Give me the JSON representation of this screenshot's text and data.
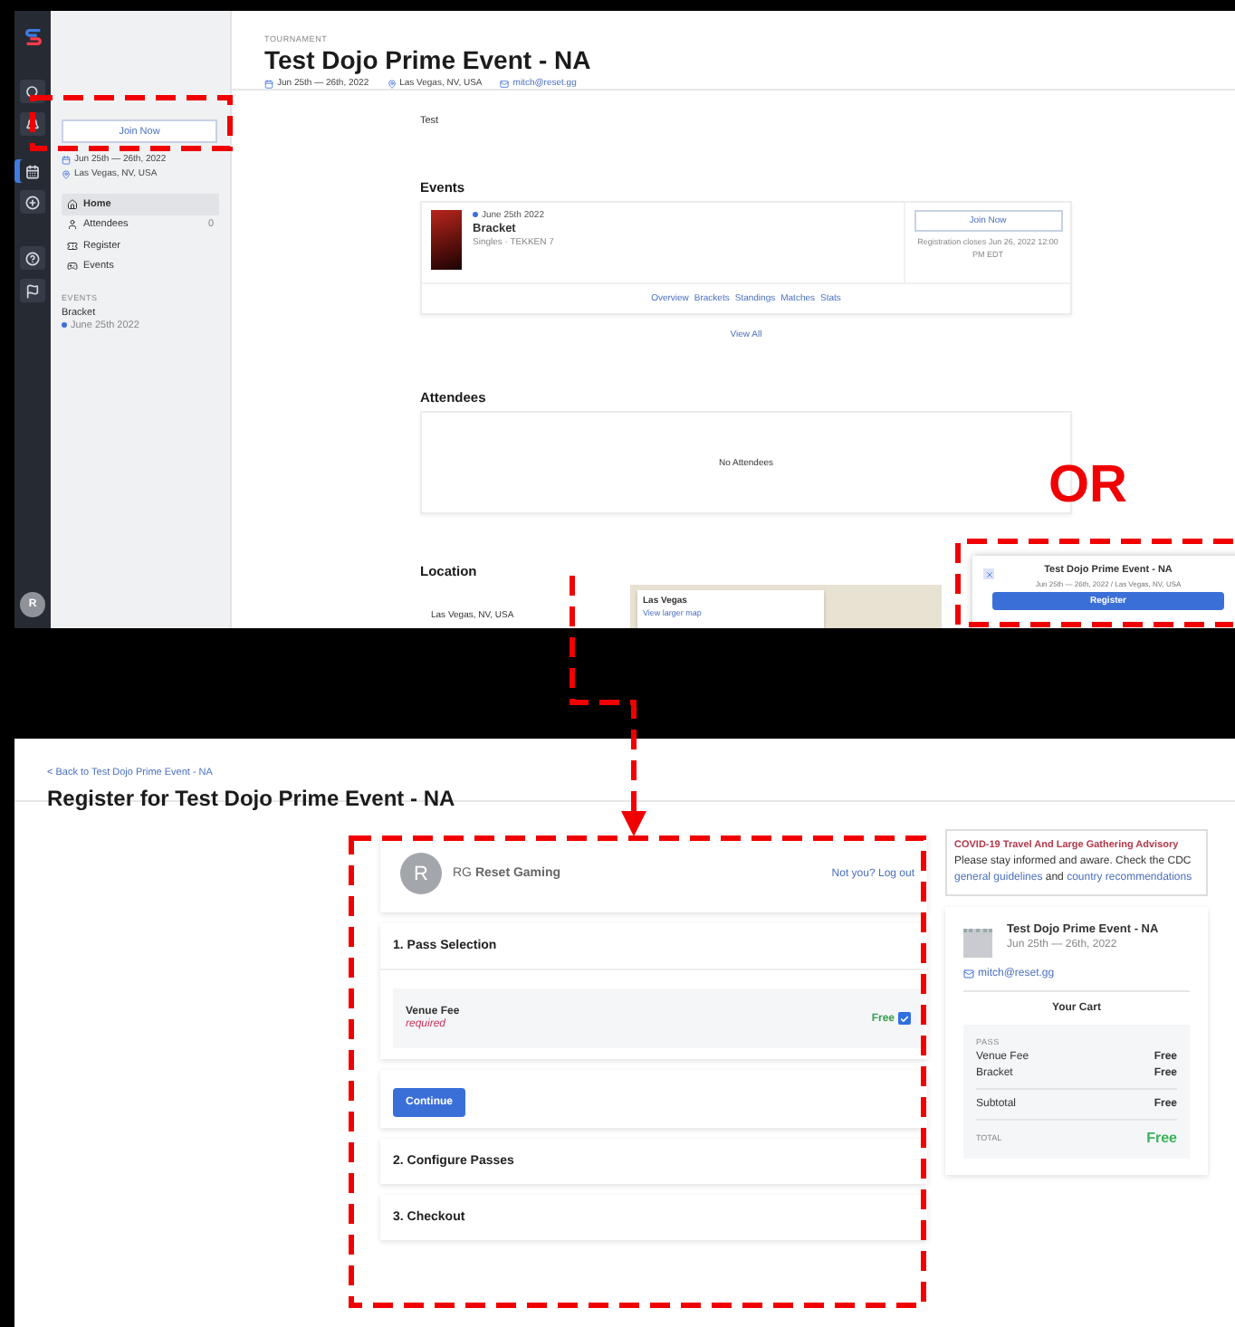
{
  "event_page": {
    "nav_rail": [
      {
        "selected": false
      },
      {
        "selected": false
      },
      {
        "selected": true
      },
      {
        "selected": false
      },
      {
        "selected": false
      },
      {
        "selected": false
      }
    ],
    "avatar_initial": "R",
    "sidebar": {
      "join_button": "Join Now",
      "date": "Jun 25th — 26th, 2022",
      "location": "Las Vegas, NV, USA",
      "items": [
        {
          "label": "Home",
          "selected": true
        },
        {
          "label": "Attendees",
          "count": "0",
          "selected": false
        },
        {
          "label": "Register",
          "selected": false
        },
        {
          "label": "Events",
          "selected": false
        }
      ],
      "events_heading": "EVENTS",
      "events": [
        {
          "name": "Bracket",
          "date": "June 25th 2022"
        }
      ]
    },
    "header": {
      "eyebrow": "TOURNAMENT",
      "title": "Test Dojo Prime Event - NA",
      "date": "Jun 25th — 26th, 2022",
      "location": "Las Vegas, NV, USA",
      "email": "mitch@reset.gg"
    },
    "description": "Test",
    "events_section": {
      "heading": "Events",
      "event": {
        "date": "June 25th 2022",
        "name": "Bracket",
        "subtitle": "Singles · TEKKEN 7",
        "join_button": "Join Now",
        "registration_note": "Registration closes Jun 26, 2022 12:00 PM EDT",
        "links": [
          "Overview",
          "Brackets",
          "Standings",
          "Matches",
          "Stats"
        ]
      },
      "view_all": "View All"
    },
    "attendees_section": {
      "heading": "Attendees",
      "empty_text": "No Attendees"
    },
    "location_section": {
      "heading": "Location",
      "address": "Las Vegas, NV, USA",
      "map_card": {
        "place": "Las Vegas",
        "link": "View larger map"
      }
    },
    "popup": {
      "title": "Test Dojo Prime Event - NA",
      "subtitle": "Jun 25th — 26th, 2022 / Las Vegas, NV, USA",
      "button": "Register"
    }
  },
  "annotation": {
    "label": "OR"
  },
  "register_page": {
    "back_link": "< Back to Test Dojo Prime Event - NA",
    "title": "Register for Test Dojo Prime Event - NA",
    "profile": {
      "initial": "R",
      "name": "RG **Reset Gaming**",
      "logout": "Not you? Log out"
    },
    "steps": [
      {
        "title": "1. Pass Selection",
        "expanded": true
      },
      {
        "title": "2. Configure Passes",
        "expanded": false
      },
      {
        "title": "3. Checkout",
        "expanded": false
      }
    ],
    "passes": [
      {
        "name": "Venue Fee",
        "note": "required",
        "price": "Free",
        "checked": true
      }
    ],
    "continue_button": "Continue",
    "advisory": {
      "title": "COVID-19 Travel And Large Gathering Advisory",
      "text_before": "Please stay informed and aware. Check the CDC",
      "link_1": "general guidelines",
      "text_middle": "and",
      "link_2": "country recommendations"
    },
    "event_card": {
      "title": "Test Dojo Prime Event - NA",
      "date": "Jun 25th — 26th, 2022",
      "email": "mitch@reset.gg"
    },
    "cart": {
      "heading": "Your Cart",
      "section_label": "PASS",
      "items": [
        {
          "name": "Venue Fee",
          "price": "Free"
        },
        {
          "name": "Bracket",
          "price": "Free"
        }
      ],
      "subtotal": {
        "label": "Subtotal",
        "value": "Free"
      },
      "total": {
        "label": "TOTAL",
        "value": "Free"
      }
    }
  }
}
